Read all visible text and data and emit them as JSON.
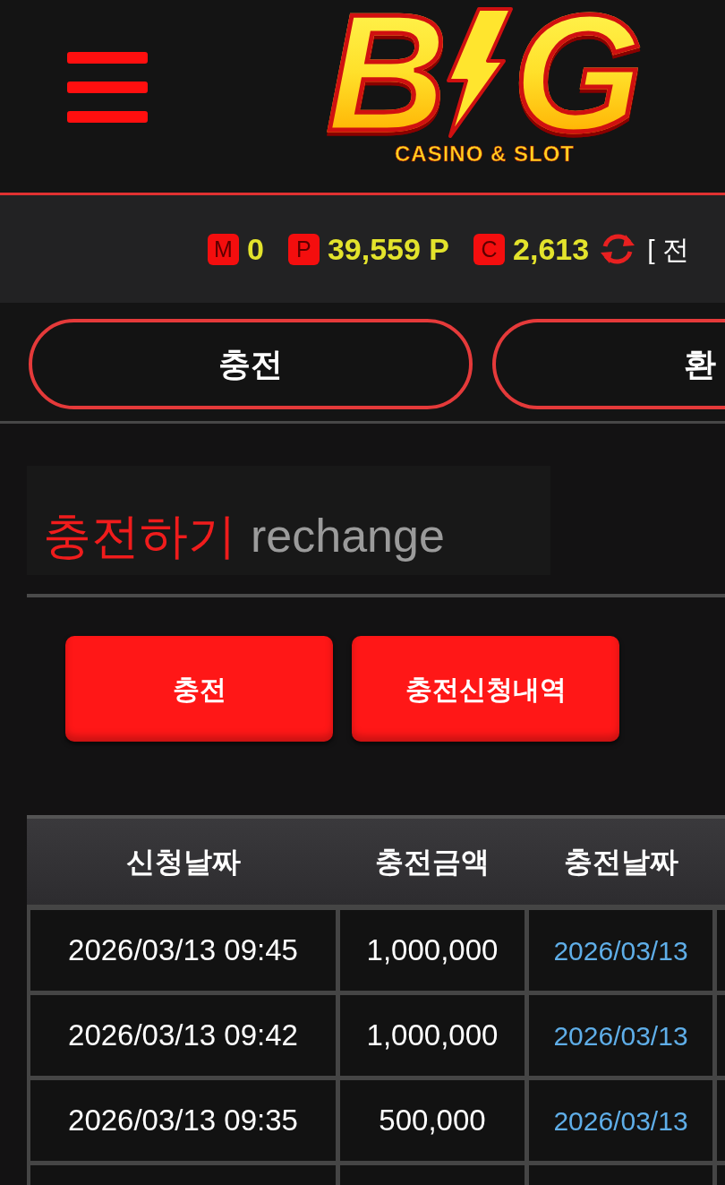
{
  "header": {
    "logo": {
      "left_letter": "B",
      "right_letter": "G",
      "tagline": "CASINO & SLOT"
    }
  },
  "balances": [
    {
      "badge": "M",
      "value": "0"
    },
    {
      "badge": "P",
      "value": "39,559 P"
    },
    {
      "badge": "C",
      "value": "2,613"
    }
  ],
  "convert_link": "[ 전",
  "tabs": [
    {
      "label": "충전",
      "selected": false
    },
    {
      "label": "환",
      "selected": false
    }
  ],
  "page_title": {
    "korean": "충전하기",
    "english": "rechange"
  },
  "actions": [
    "충전",
    "충전신청내역"
  ],
  "table": {
    "columns": [
      "신청날짜",
      "충전금액",
      "충전날짜"
    ],
    "rows": [
      {
        "cells": [
          "2026/03/13 09:45",
          "1,000,000",
          "2026/03/13"
        ]
      },
      {
        "cells": [
          "2026/03/13 09:42",
          "1,000,000",
          "2026/03/13"
        ]
      },
      {
        "cells": [
          "2026/03/13 09:35",
          "500,000",
          "2026/03/13"
        ]
      }
    ],
    "cut_off_column": true,
    "cut_off_row": true
  }
}
